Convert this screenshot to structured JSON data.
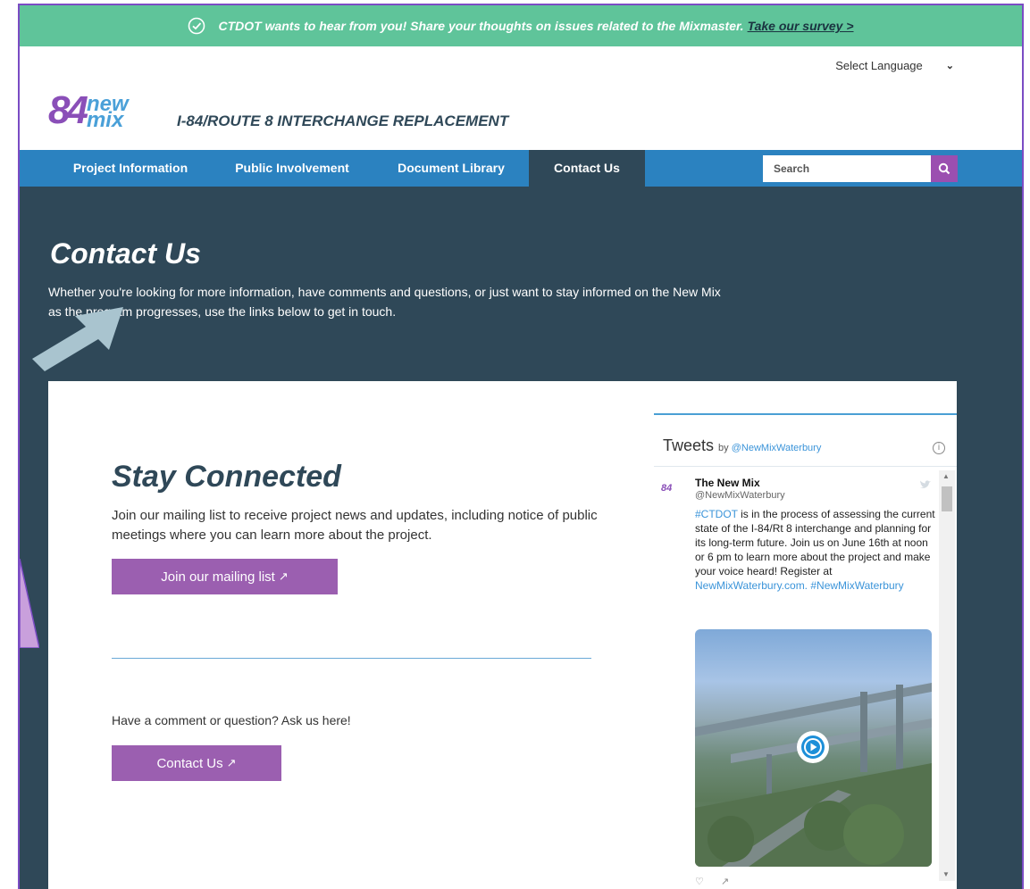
{
  "banner": {
    "text": "CTDOT wants to hear from you!  Share your thoughts on issues related to the Mixmaster.",
    "link": "Take our survey >"
  },
  "header": {
    "language": "Select Language",
    "logo_number": "84",
    "logo_new": "new",
    "logo_mix": "mix",
    "site_title": "I-84/ROUTE 8 INTERCHANGE REPLACEMENT"
  },
  "nav": {
    "items": [
      "Project Information",
      "Public Involvement",
      "Document Library",
      "Contact Us"
    ],
    "active": "Contact Us",
    "search_placeholder": "Search"
  },
  "main": {
    "title": "Contact Us",
    "intro": "Whether you're looking for more information, have comments and questions, or just want to stay informed on the New Mix as the program progresses, use the links below to get in touch."
  },
  "stay_connected": {
    "title": "Stay Connected",
    "description": "Join our mailing list to receive project news and updates, including notice of public meetings where you can learn more about the project.",
    "mailing_button": "Join our mailing list",
    "comment_text": "Have a comment or question? Ask us here!",
    "contact_button": "Contact Us"
  },
  "twitter": {
    "heading": "Tweets",
    "by": "by",
    "handle_link": "@NewMixWaterbury",
    "info": "i",
    "author_name": "The New Mix",
    "author_handle": "@NewMixWaterbury",
    "avatar_text": "84",
    "tweet_hashtag1": "#CTDOT",
    "tweet_body": " is in the process of assessing the current state of the I-84/Rt 8 interchange and planning for its long-term future. Join us on June 16th at noon or 6 pm to learn more about the project and make your voice heard! Register at ",
    "tweet_link": "NewMixWaterbury.com.",
    "tweet_hashtag2": "#NewMixWaterbury"
  },
  "colors": {
    "banner": "#5fc49a",
    "nav": "#2b82c0",
    "hero": "#2f4858",
    "button": "#9b5fb0",
    "accent_purple": "#8a4fb8"
  }
}
